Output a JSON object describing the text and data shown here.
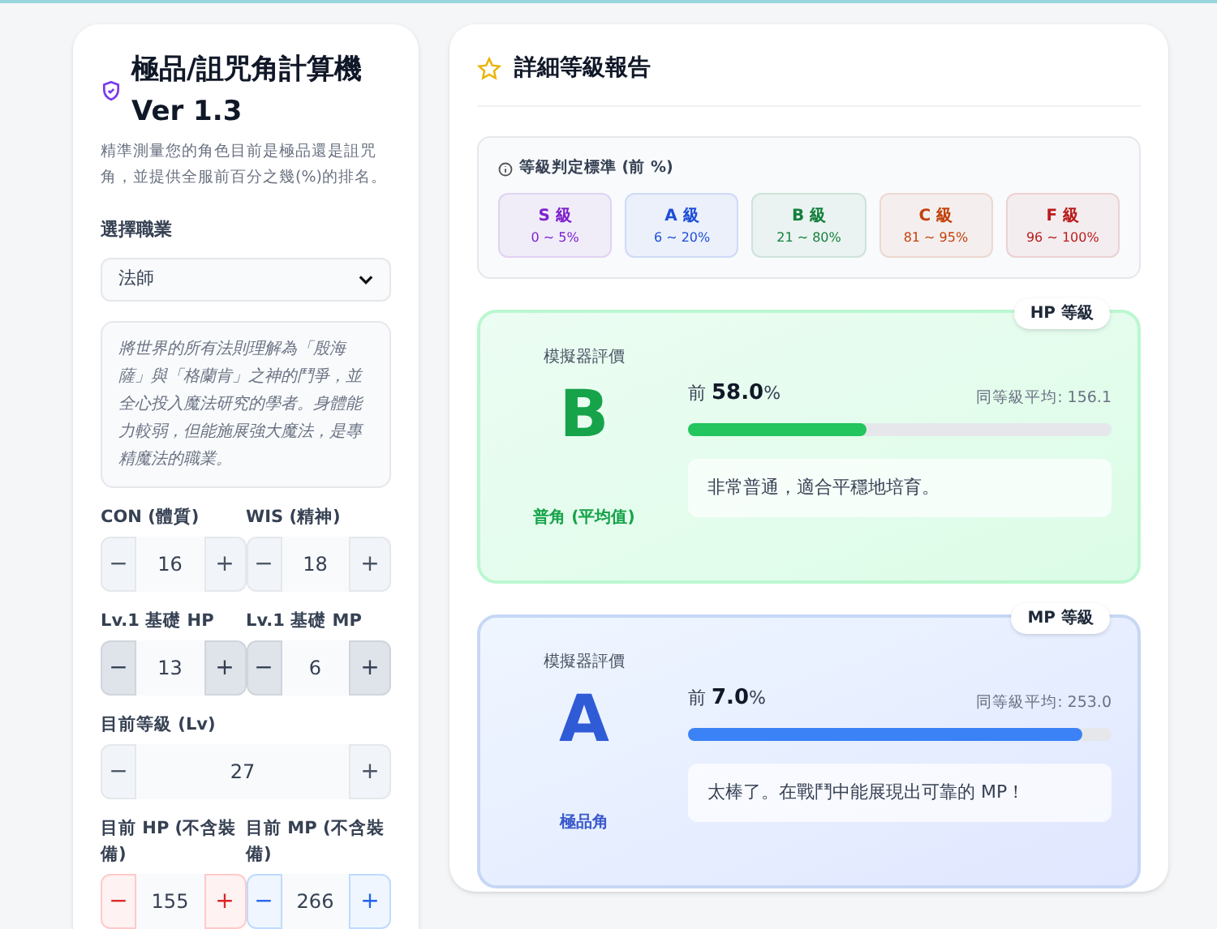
{
  "calculator": {
    "title": "極品/詛咒角計算機",
    "version": "Ver 1.3",
    "subtitle": "精準測量您的角色目前是極品還是詛咒角，並提供全服前百分之幾(%)的排名。",
    "class_label": "選擇職業",
    "class_value": "法師",
    "class_description": "將世界的所有法則理解為「殷海薩」與「格蘭肯」之神的鬥爭，並全心投入魔法研究的學者。身體能力較弱，但能施展強大魔法，是專精魔法的職業。",
    "field_rows": [
      [
        {
          "label": "CON (體質)",
          "value": "16",
          "kind": "plain",
          "minus": "−",
          "plus": "+"
        },
        {
          "label": "WIS (精神)",
          "value": "18",
          "kind": "plain",
          "minus": "−",
          "plus": "+"
        }
      ],
      [
        {
          "label": "Lv.1 基礎 HP",
          "value": "13",
          "kind": "gray",
          "minus": "−",
          "plus": "+"
        },
        {
          "label": "Lv.1 基礎 MP",
          "value": "6",
          "kind": "gray",
          "minus": "−",
          "plus": "+"
        }
      ],
      [
        {
          "label": "目前等級 (Lv)",
          "value": "27",
          "kind": "plain",
          "minus": "−",
          "plus": "+"
        }
      ],
      [
        {
          "label": "目前 HP (不含裝備)",
          "value": "155",
          "kind": "red",
          "minus": "−",
          "plus": "+"
        },
        {
          "label": "目前 MP (不含裝備)",
          "value": "266",
          "kind": "blue",
          "minus": "−",
          "plus": "+"
        }
      ]
    ]
  },
  "report": {
    "title": "詳細等級報告",
    "standards_title": "等級判定標準 (前 %)",
    "grades": [
      {
        "grade": "S 級",
        "range": "0 ~ 5%",
        "color": "#7e22ce"
      },
      {
        "grade": "A 級",
        "range": "6 ~ 20%",
        "color": "#1d4ed8"
      },
      {
        "grade": "B 級",
        "range": "21 ~ 80%",
        "color": "#15803d"
      },
      {
        "grade": "C 級",
        "range": "81 ~ 95%",
        "color": "#c2410c"
      },
      {
        "grade": "F 級",
        "range": "96 ~ 100%",
        "color": "#b91c1c"
      }
    ],
    "results": [
      {
        "badge": "HP 等級",
        "kind": "green",
        "eval_label": "模擬器評價",
        "grade": "B",
        "verdict": "普角 (平均值)",
        "prefix": "前",
        "percent": "58.0",
        "percent_sign": "%",
        "average": "同等級平均: 156.1",
        "level": 0.42,
        "comment": "非常普通，適合平穩地培育。"
      },
      {
        "badge": "MP 等級",
        "kind": "blue",
        "eval_label": "模擬器評價",
        "grade": "A",
        "verdict": "極品角",
        "prefix": "前",
        "percent": "7.0",
        "percent_sign": "%",
        "average": "同等級平均: 253.0",
        "level": 0.93,
        "comment": "太棒了。在戰鬥中能展現出可靠的 MP！"
      }
    ]
  }
}
